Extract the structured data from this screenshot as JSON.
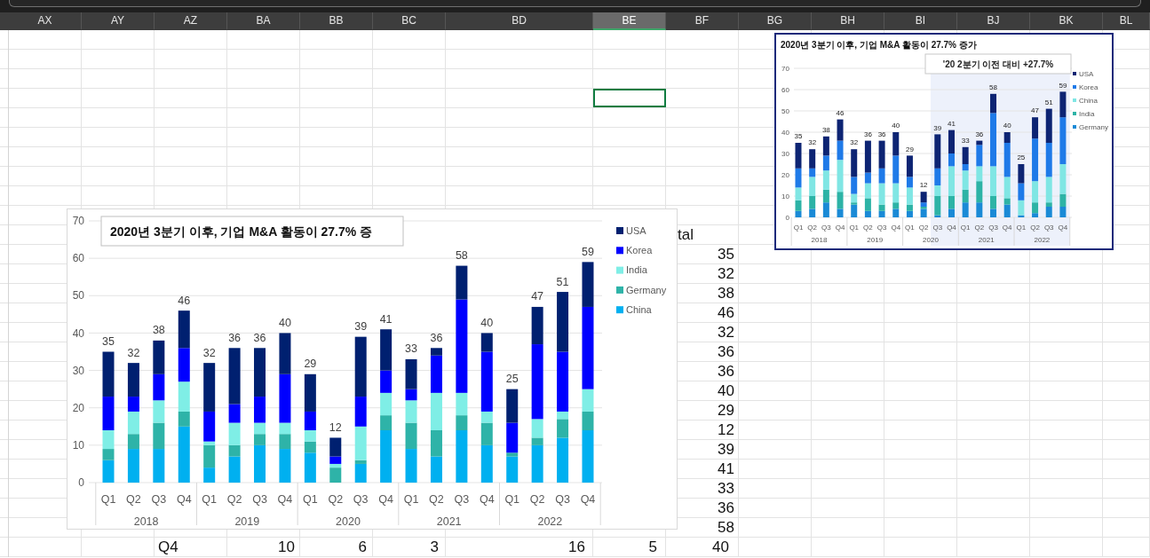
{
  "sheet": {
    "columns": [
      {
        "label": "AX",
        "selected": false
      },
      {
        "label": "AY",
        "selected": false
      },
      {
        "label": "AZ",
        "selected": false
      },
      {
        "label": "BA",
        "selected": false
      },
      {
        "label": "BB",
        "selected": false
      },
      {
        "label": "BC",
        "selected": false
      },
      {
        "label": "BD",
        "selected": false
      },
      {
        "label": "BE",
        "selected": true
      },
      {
        "label": "BF",
        "selected": false
      },
      {
        "label": "BG",
        "selected": false
      },
      {
        "label": "BH",
        "selected": false
      },
      {
        "label": "BI",
        "selected": false
      },
      {
        "label": "BJ",
        "selected": false
      },
      {
        "label": "BK",
        "selected": false
      },
      {
        "label": "BL",
        "selected": false
      }
    ],
    "rows": [
      {
        "cells": [
          null,
          null,
          null,
          null,
          null,
          null,
          null,
          null,
          {
            "kind": "text",
            "text": "tal"
          }
        ]
      },
      {
        "cells": [
          null,
          null,
          null,
          null,
          null,
          null,
          null,
          null,
          {
            "kind": "number",
            "text": "35"
          }
        ]
      },
      {
        "cells": [
          null,
          null,
          null,
          null,
          null,
          null,
          null,
          null,
          {
            "kind": "number",
            "text": "32"
          }
        ]
      },
      {
        "cells": [
          null,
          null,
          null,
          null,
          null,
          null,
          null,
          null,
          {
            "kind": "number",
            "text": "38"
          }
        ]
      },
      {
        "cells": [
          null,
          null,
          null,
          null,
          null,
          null,
          null,
          null,
          {
            "kind": "number",
            "text": "46"
          }
        ]
      },
      {
        "cells": [
          null,
          null,
          null,
          null,
          null,
          null,
          null,
          null,
          {
            "kind": "number",
            "text": "32"
          }
        ]
      },
      {
        "cells": [
          null,
          null,
          null,
          null,
          null,
          null,
          null,
          null,
          {
            "kind": "number",
            "text": "36"
          }
        ]
      },
      {
        "cells": [
          null,
          null,
          null,
          null,
          null,
          null,
          null,
          null,
          {
            "kind": "number",
            "text": "36"
          }
        ]
      },
      {
        "cells": [
          null,
          null,
          null,
          null,
          null,
          null,
          null,
          null,
          {
            "kind": "number",
            "text": "40"
          }
        ]
      },
      {
        "cells": [
          null,
          null,
          null,
          null,
          null,
          null,
          null,
          null,
          {
            "kind": "number",
            "text": "29"
          }
        ]
      },
      {
        "cells": [
          null,
          null,
          null,
          null,
          null,
          null,
          null,
          null,
          {
            "kind": "number",
            "text": "12"
          }
        ]
      },
      {
        "cells": [
          null,
          null,
          null,
          null,
          null,
          null,
          null,
          null,
          {
            "kind": "number",
            "text": "39"
          }
        ]
      },
      {
        "cells": [
          null,
          null,
          null,
          null,
          null,
          null,
          null,
          null,
          {
            "kind": "number",
            "text": "41"
          }
        ]
      },
      {
        "cells": [
          null,
          null,
          null,
          null,
          null,
          null,
          null,
          null,
          {
            "kind": "number",
            "text": "33"
          }
        ]
      },
      {
        "cells": [
          null,
          null,
          null,
          null,
          null,
          null,
          null,
          null,
          {
            "kind": "number",
            "text": "36"
          }
        ]
      },
      {
        "cells": [
          null,
          null,
          null,
          null,
          null,
          null,
          null,
          null,
          {
            "kind": "number",
            "text": "58"
          }
        ]
      },
      {
        "cells": [
          null,
          null,
          {
            "kind": "text",
            "text": "Q4"
          },
          {
            "kind": "number",
            "text": "10"
          },
          {
            "kind": "number",
            "text": "6"
          },
          {
            "kind": "number",
            "text": "3"
          },
          {
            "kind": "number",
            "text": "16"
          },
          {
            "kind": "number",
            "text": "5"
          },
          {
            "kind": "number",
            "text": "40"
          }
        ]
      }
    ]
  },
  "charts": [
    {
      "kind": "chart_object",
      "title": "2020년 3분기 이후, 기업 M&A 활동이 27.7% 증",
      "year_groups": [
        "2018",
        "2019",
        "2020",
        "2021",
        "2022"
      ],
      "chart_data": {
        "type": "bar",
        "stacked": true,
        "grid": true,
        "legend": true,
        "categories": [
          "Q1",
          "Q2",
          "Q3",
          "Q4",
          "Q1",
          "Q2",
          "Q3",
          "Q4",
          "Q1",
          "Q2",
          "Q3",
          "Q4",
          "Q1",
          "Q2",
          "Q3",
          "Q4",
          "Q1",
          "Q2",
          "Q3",
          "Q4"
        ],
        "ylim": [
          0,
          70
        ],
        "yticks": [
          0,
          10,
          20,
          30,
          40,
          50,
          60,
          70
        ],
        "series": [
          {
            "name": "China",
            "color": "#00b0f0",
            "values": [
              6,
              9,
              9,
              15,
              4,
              7,
              10,
              9,
              8,
              0,
              5,
              14,
              9,
              7,
              14,
              10,
              7,
              10,
              12,
              14
            ]
          },
          {
            "name": "Germany",
            "color": "#2eb3a8",
            "values": [
              3,
              4,
              7,
              4,
              6,
              3,
              3,
              4,
              3,
              4,
              1,
              4,
              7,
              7,
              4,
              6,
              1,
              2,
              5,
              5
            ]
          },
          {
            "name": "India",
            "color": "#7feee6",
            "values": [
              5,
              6,
              6,
              8,
              1,
              6,
              3,
              3,
              3,
              1,
              9,
              6,
              6,
              10,
              6,
              3,
              0,
              5,
              2,
              6
            ]
          },
          {
            "name": "Korea",
            "color": "#0000ff",
            "values": [
              9,
              4,
              7,
              9,
              8,
              5,
              7,
              13,
              5,
              2,
              8,
              6,
              3,
              10,
              25,
              16,
              8,
              20,
              16,
              22
            ]
          },
          {
            "name": "USA",
            "color": "#002070",
            "values": [
              12,
              9,
              9,
              10,
              13,
              15,
              13,
              11,
              10,
              5,
              16,
              11,
              8,
              2,
              9,
              5,
              9,
              10,
              16,
              12
            ]
          }
        ],
        "value_labels": [
          "35",
          "32",
          "38",
          "46",
          "32",
          "36",
          "36",
          "40",
          "29",
          "12",
          "39",
          "41",
          "33",
          "36",
          "58",
          "40",
          "25",
          "47",
          "51",
          "59"
        ]
      }
    },
    {
      "kind": "pasted_image",
      "title": "2020년 3분기 이후, 기업 M&A 활동이 27.7% 증가",
      "annotation": "'20 2분기 이전 대비 +27.7%",
      "year_groups": [
        "2018",
        "2019",
        "2020",
        "2021",
        "2022"
      ],
      "chart_data": {
        "type": "bar",
        "stacked": true,
        "grid": true,
        "legend": true,
        "categories": [
          "Q1",
          "Q2",
          "Q3",
          "Q4",
          "Q1",
          "Q2",
          "Q3",
          "Q4",
          "Q1",
          "Q2",
          "Q3",
          "Q4",
          "Q1",
          "Q2",
          "Q3",
          "Q4",
          "Q1",
          "Q2",
          "Q3",
          "Q4"
        ],
        "ylim": [
          0,
          70
        ],
        "yticks": [
          0,
          10,
          20,
          30,
          40,
          50,
          60,
          70
        ],
        "series": [
          {
            "name": "Germany",
            "color": "#1a8ad6",
            "values": [
              3,
              4,
              7,
              4,
              6,
              3,
              3,
              4,
              3,
              4,
              1,
              4,
              7,
              7,
              4,
              6,
              1,
              2,
              5,
              5
            ]
          },
          {
            "name": "India",
            "color": "#2db3a6",
            "values": [
              5,
              6,
              6,
              8,
              1,
              6,
              3,
              3,
              3,
              1,
              9,
              6,
              6,
              10,
              6,
              3,
              0,
              5,
              2,
              6
            ]
          },
          {
            "name": "China",
            "color": "#80e6e4",
            "values": [
              6,
              9,
              9,
              15,
              4,
              7,
              10,
              9,
              8,
              0,
              5,
              14,
              9,
              7,
              14,
              10,
              7,
              10,
              12,
              14
            ]
          },
          {
            "name": "Korea",
            "color": "#1f7ae8",
            "values": [
              9,
              4,
              7,
              9,
              8,
              5,
              7,
              13,
              5,
              2,
              8,
              6,
              3,
              10,
              25,
              16,
              8,
              20,
              16,
              22
            ]
          },
          {
            "name": "USA",
            "color": "#0d2473",
            "values": [
              12,
              9,
              9,
              10,
              13,
              15,
              13,
              11,
              10,
              5,
              16,
              11,
              8,
              2,
              9,
              5,
              9,
              10,
              16,
              12
            ]
          }
        ],
        "value_labels": [
          "35",
          "32",
          "38",
          "46",
          "32",
          "36",
          "36",
          "40",
          "29",
          "12",
          "39",
          "41",
          "33",
          "36",
          "58",
          "40",
          "25",
          "47",
          "51",
          "59"
        ]
      }
    }
  ]
}
